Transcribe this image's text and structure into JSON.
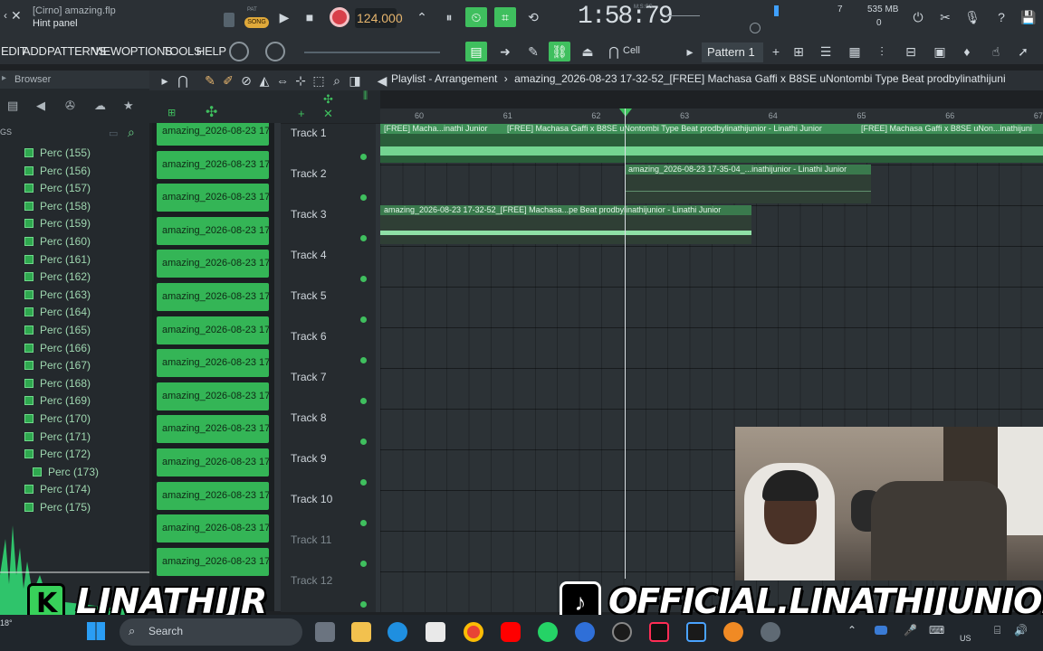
{
  "app": {
    "hint_line1": "[Cirno] amazing.flp",
    "hint_line2": "Hint panel",
    "tempo": "124.000",
    "time": "1:58:79",
    "time_units": "M:S:CS",
    "cpu_value": "7",
    "memory": "535 MB",
    "poly": "0",
    "snap": "Cell",
    "pattern": "Pattern 1",
    "song_label": "SONG",
    "pat_label": "PAT"
  },
  "menu": [
    "EDIT",
    "ADD",
    "PATTERNS",
    "VIEW",
    "OPTIONS",
    "TOOLS",
    "HELP"
  ],
  "browser": {
    "title": "Browser",
    "side_label": "GS",
    "items": [
      "Perc (155)",
      "Perc (156)",
      "Perc (157)",
      "Perc (158)",
      "Perc (159)",
      "Perc (160)",
      "Perc (161)",
      "Perc (162)",
      "Perc (163)",
      "Perc (164)",
      "Perc (165)",
      "Perc (166)",
      "Perc (167)",
      "Perc (168)",
      "Perc (169)",
      "Perc (170)",
      "Perc (171)",
      "Perc (172)",
      "Perc (173)",
      "Perc (174)",
      "Perc (175)"
    ],
    "selected_child": "Perc (173)"
  },
  "clips": [
    "amazing_2026-08-23 17...",
    "amazing_2026-08-23 17...",
    "amazing_2026-08-23 17...",
    "amazing_2026-08-23 17...",
    "amazing_2026-08-23 17...",
    "amazing_2026-08-23 17...",
    "amazing_2026-08-23 17...",
    "amazing_2026-08-23 17...",
    "amazing_2026-08-23 17...",
    "amazing_2026-08-23 17...",
    "amazing_2026-08-23 17...",
    "amazing_2026-08-23 17...",
    "amazing_2026-08-23 17...",
    "amazing_2026-08-23 17..."
  ],
  "playlist": {
    "title": "Playlist - Arrangement",
    "file": "amazing_2026-08-23 17-32-52_[FREE] Machasa Gaffi x B8SE uNontombi Type Beat  prodbylinathijuni",
    "ruler": [
      "60",
      "61",
      "62",
      "63",
      "64",
      "65",
      "66",
      "67"
    ],
    "tracks": [
      "Track 1",
      "Track 2",
      "Track 3",
      "Track 4",
      "Track 5",
      "Track 6",
      "Track 7",
      "Track 8",
      "Track 9",
      "Track 10",
      "Track 11",
      "Track 12"
    ],
    "patterns": [
      {
        "track": 1,
        "label": "[FREE] Macha...inathi Junior"
      },
      {
        "track": 1,
        "label": "[FREE] Machasa Gaffi x B8SE uNontombi Type Beat  prodbylinathijunior - Linathi Junior"
      },
      {
        "track": 1,
        "label": "[FREE] Machasa Gaffi x B8SE uNon...inathijuni"
      },
      {
        "track": 2,
        "label": "amazing_2026-08-23 17-35-04_...inathijunior - Linathi Junior"
      },
      {
        "track": 3,
        "label": "amazing_2026-08-23 17-32-52_[FREE] Machasa...pe Beat  prodbylinathijunior - Linathi Junior"
      }
    ]
  },
  "overlays": {
    "left_handle": "LINATHIJR",
    "left_logo_letter": "K",
    "right_handle": "OFFICIAL.LINATHIJUNIOR"
  },
  "taskbar": {
    "search_placeholder": "Search",
    "locale": "US",
    "temp": "18°"
  }
}
